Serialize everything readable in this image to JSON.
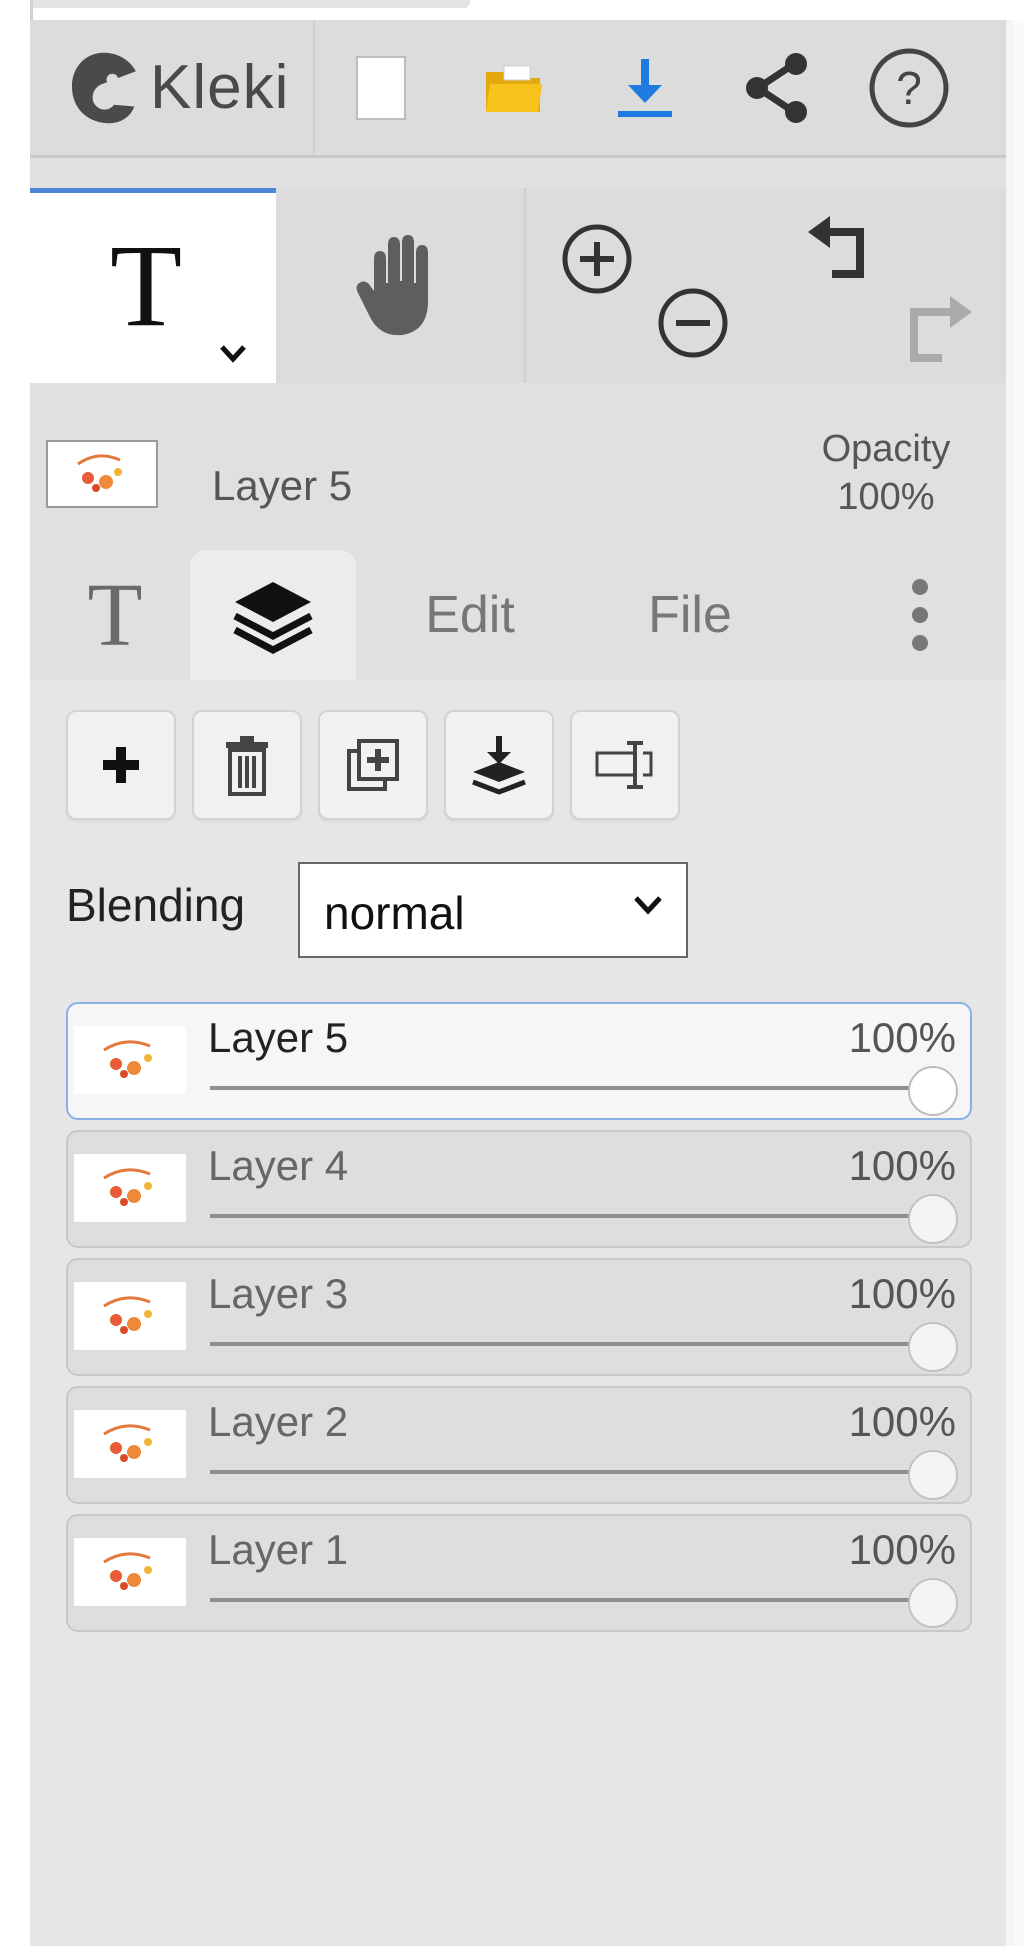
{
  "app": {
    "name": "Kleki"
  },
  "header": {
    "icons": [
      "new-image-icon",
      "open-folder-icon",
      "download-icon",
      "share-icon",
      "help-icon"
    ],
    "colors": {
      "folder": "#f6c21b",
      "download": "#1f7be0",
      "icon": "#333333"
    }
  },
  "tools": {
    "text_tool": "T",
    "accent": "#4a86d8"
  },
  "layer_info": {
    "name": "Layer 5",
    "opacity_label": "Opacity",
    "opacity_value": "100%"
  },
  "tabs": {
    "text": "T",
    "edit": "Edit",
    "file": "File"
  },
  "blending": {
    "label": "Blending",
    "value": "normal"
  },
  "layers": [
    {
      "name": "Layer 5",
      "opacity": "100%",
      "opacity_fraction": 1.0,
      "active": true
    },
    {
      "name": "Layer 4",
      "opacity": "100%",
      "opacity_fraction": 1.0,
      "active": false
    },
    {
      "name": "Layer 3",
      "opacity": "100%",
      "opacity_fraction": 1.0,
      "active": false
    },
    {
      "name": "Layer 2",
      "opacity": "100%",
      "opacity_fraction": 1.0,
      "active": false
    },
    {
      "name": "Layer 1",
      "opacity": "100%",
      "opacity_fraction": 1.0,
      "active": false
    }
  ]
}
